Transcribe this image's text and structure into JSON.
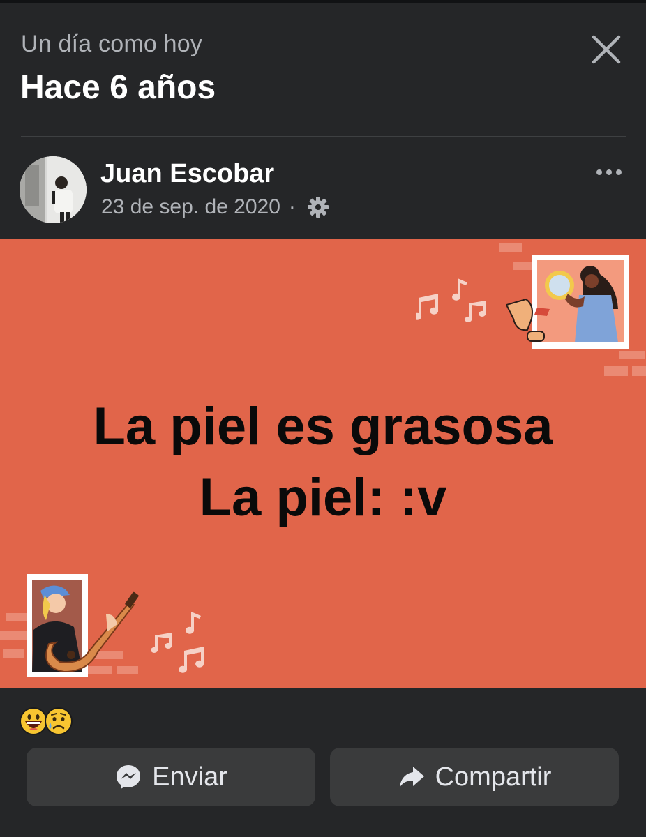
{
  "header": {
    "subtitle": "Un día como hoy",
    "title": "Hace 6 años"
  },
  "post": {
    "author": "Juan Escobar",
    "date": "23 de sep. de 2020",
    "separator": "·",
    "privacy_icon": "gear-icon",
    "text_line1": "La piel es grasosa",
    "text_line2": "La piel: :v",
    "background_color": "#e1654a",
    "reactions": [
      "grinning-face-icon",
      "sad-tear-face-icon"
    ]
  },
  "actions": {
    "send_label": "Enviar",
    "share_label": "Compartir"
  },
  "colors": {
    "background": "#252628",
    "button": "#3a3b3c",
    "text_primary": "#ffffff",
    "text_secondary": "#b0b3b8"
  }
}
